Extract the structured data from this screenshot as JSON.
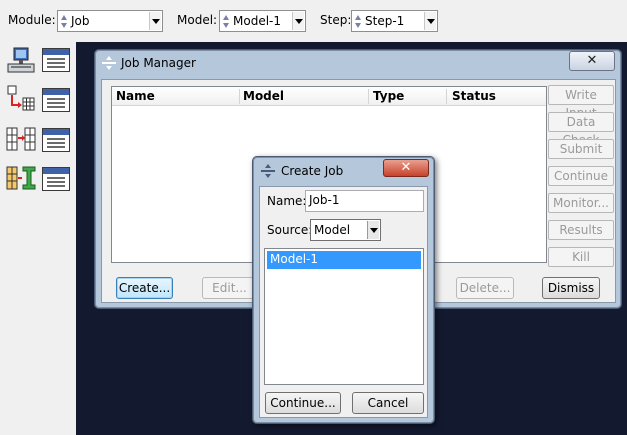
{
  "topbar": {
    "module_label": "Module:",
    "module_value": "Job",
    "model_label": "Model:",
    "model_value": "Model-1",
    "step_label": "Step:",
    "step_value": "Step-1"
  },
  "toolbox": {
    "icons": [
      "job-computer-icon",
      "job-manager-panel-icon",
      "adaptivity-icon",
      "adaptivity-manager-panel-icon",
      "coupled-analysis-icon",
      "coupled-manager-panel-icon",
      "cosimulation-icon",
      "cosimulation-manager-panel-icon"
    ]
  },
  "job_manager": {
    "title": "Job Manager",
    "close": "✕",
    "columns": [
      "Name",
      "Model",
      "Type",
      "Status"
    ],
    "side_buttons": [
      "Write Input",
      "Data Check",
      "Submit",
      "Continue",
      "Monitor...",
      "Results",
      "Kill"
    ],
    "create_label": "Create...",
    "edit_label": "Edit...",
    "delete_label": "Delete...",
    "dismiss_label": "Dismiss"
  },
  "create_job": {
    "title": "Create Job",
    "close": "✕",
    "name_label": "Name:",
    "name_value": "Job-1",
    "source_label": "Source:",
    "source_value": "Model",
    "list_items": [
      "Model-1"
    ],
    "continue_label": "Continue...",
    "cancel_label": "Cancel"
  },
  "colors": {
    "viewport": "#131a30",
    "dialog_frame": "#b4c7db",
    "selection": "#3399ff",
    "close_red": "#c8412b"
  }
}
